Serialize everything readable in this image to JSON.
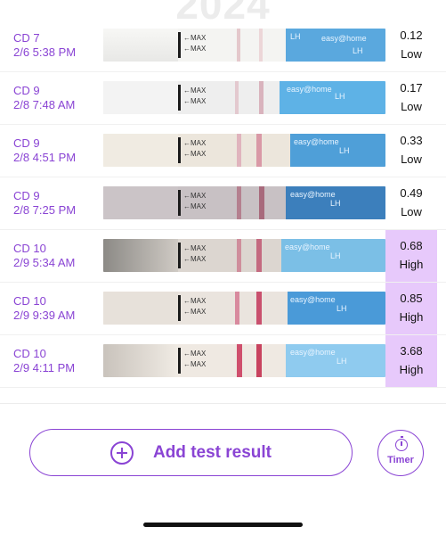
{
  "header": {
    "year_partial": "2024"
  },
  "tests": [
    {
      "cd": "CD 7",
      "datetime": "2/6 5:38 PM",
      "value": "0.12",
      "level": "Low"
    },
    {
      "cd": "CD 9",
      "datetime": "2/8 7:48 AM",
      "value": "0.17",
      "level": "Low"
    },
    {
      "cd": "CD 9",
      "datetime": "2/8 4:51 PM",
      "value": "0.33",
      "level": "Low"
    },
    {
      "cd": "CD 9",
      "datetime": "2/8 7:25 PM",
      "value": "0.49",
      "level": "Low"
    },
    {
      "cd": "CD 10",
      "datetime": "2/9 5:34 AM",
      "value": "0.68",
      "level": "High"
    },
    {
      "cd": "CD 10",
      "datetime": "2/9 9:39 AM",
      "value": "0.85",
      "level": "High"
    },
    {
      "cd": "CD 10",
      "datetime": "2/9 4:11 PM",
      "value": "3.68",
      "level": "High"
    }
  ],
  "strip_text": {
    "max_label": "←MAX",
    "lh_label": "LH",
    "brand": "easy@home"
  },
  "actions": {
    "add_label": "Add test result",
    "timer_label": "Timer"
  },
  "colors": {
    "accent": "#8a44d4",
    "high_bg": "#e7c9fb"
  }
}
